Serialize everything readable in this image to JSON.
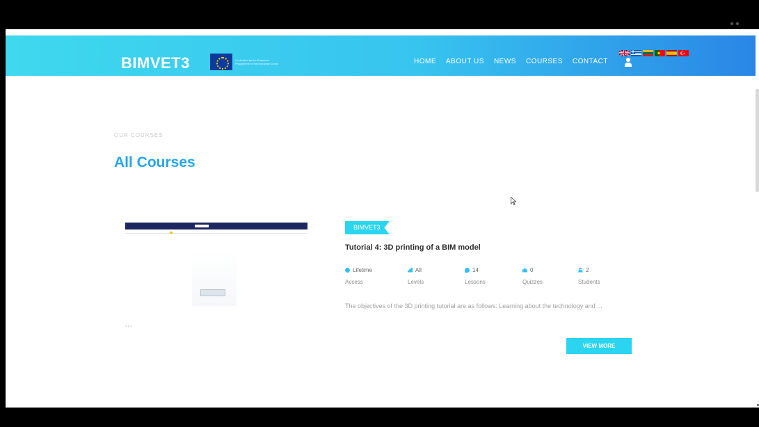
{
  "header": {
    "logo_text": "BIMVET3",
    "eu_funding_text": "Co-funded by the Erasmus+ Programme of the European Union",
    "nav": [
      "HOME",
      "ABOUT US",
      "NEWS",
      "COURSES",
      "CONTACT"
    ],
    "flags": [
      {
        "name": "uk-flag",
        "colors": [
          "#012169",
          "#ffffff",
          "#c8102e"
        ]
      },
      {
        "name": "greek-flag",
        "colors": [
          "#0d5eaf",
          "#ffffff"
        ]
      },
      {
        "name": "lithuanian-flag",
        "colors": [
          "#fdb913",
          "#006a44",
          "#c1272d"
        ]
      },
      {
        "name": "portuguese-flag",
        "colors": [
          "#006600",
          "#ff0000"
        ]
      },
      {
        "name": "spanish-flag",
        "colors": [
          "#aa151b",
          "#f1bf00"
        ]
      },
      {
        "name": "turkish-flag",
        "colors": [
          "#e30a17",
          "#ffffff"
        ]
      }
    ],
    "colors": {
      "gradient_start": "#3fd8ee",
      "gradient_end": "#2a86e6"
    }
  },
  "page": {
    "eyebrow": "OUR COURSES",
    "title": "All Courses"
  },
  "course": {
    "category": "BIMVET3",
    "title": "Tutorial 4: 3D printing of a BIM model",
    "meta": [
      {
        "icon": "clock-icon",
        "value": "Lifetime",
        "label": "Access"
      },
      {
        "icon": "bar-chart-icon",
        "value": "All",
        "label": "Levels"
      },
      {
        "icon": "chat-icon",
        "value": "14",
        "label": "Lessons"
      },
      {
        "icon": "thumbs-up-icon",
        "value": "0",
        "label": "Quizzes"
      },
      {
        "icon": "students-icon",
        "value": "2",
        "label": "Students"
      }
    ],
    "description": "The objectives of the 3D printing tutorial are as follows: Learning about the technology and ...",
    "button": "VIEW MORE",
    "accent": "#2bd4ef"
  }
}
